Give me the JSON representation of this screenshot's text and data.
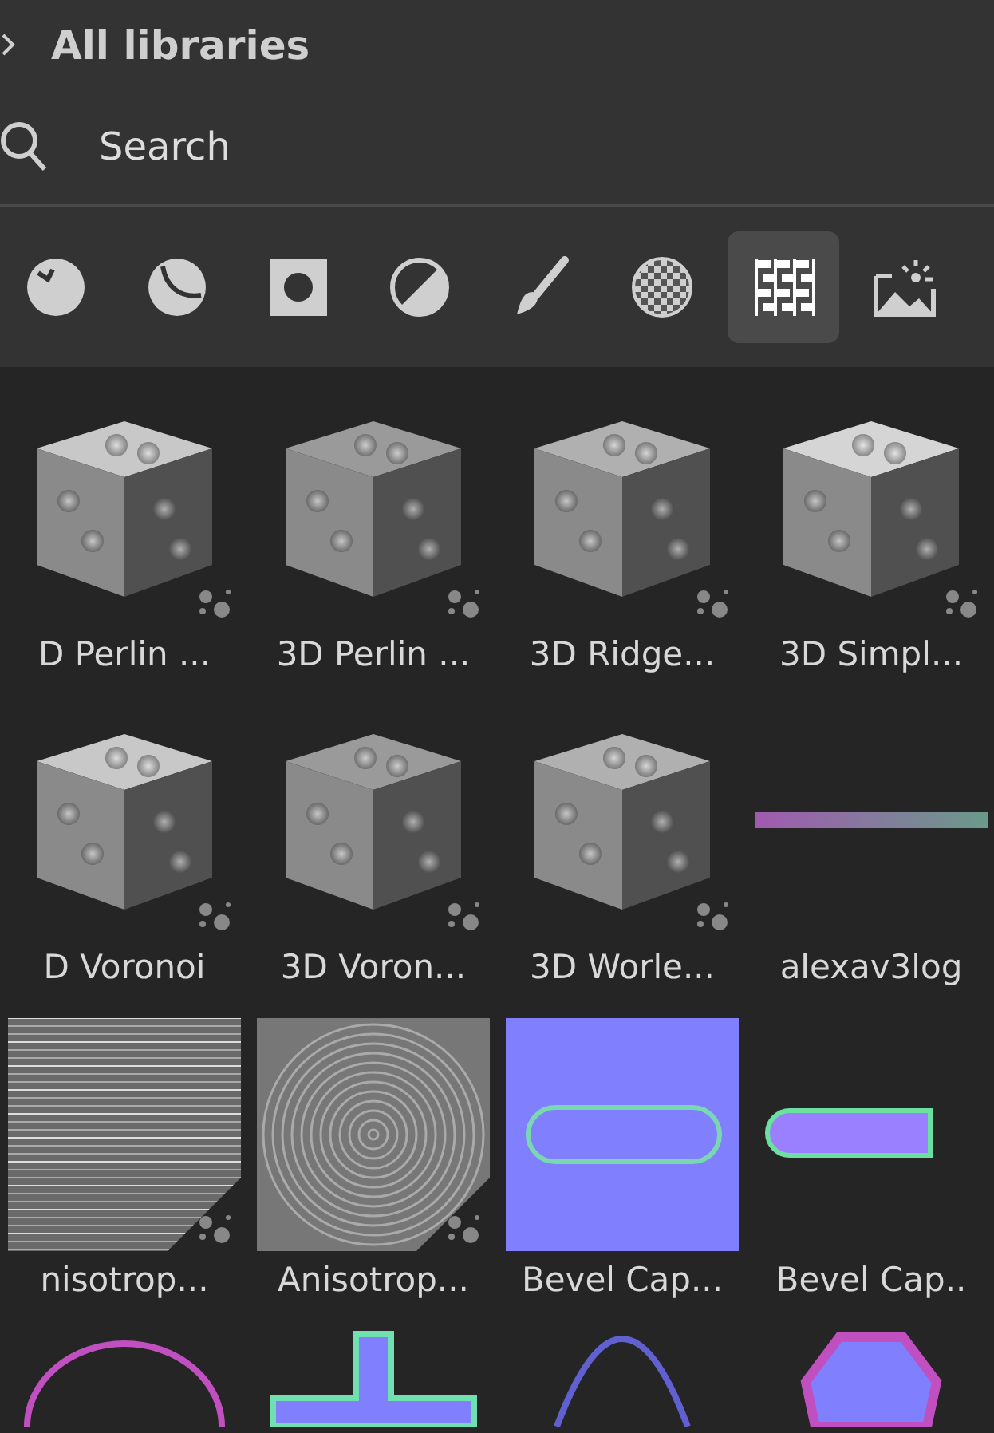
{
  "header": {
    "title": "All libraries"
  },
  "search": {
    "placeholder": "Search"
  },
  "filters": [
    {
      "kind": "sphere-check",
      "selected": false
    },
    {
      "kind": "ball",
      "selected": false
    },
    {
      "kind": "square-dot",
      "selected": false
    },
    {
      "kind": "half-circle",
      "selected": false
    },
    {
      "kind": "brush",
      "selected": false
    },
    {
      "kind": "checker",
      "selected": false
    },
    {
      "kind": "pattern",
      "selected": true
    },
    {
      "kind": "image",
      "selected": false
    }
  ],
  "items": [
    {
      "label": "D Perlin ...",
      "kind": "cube",
      "procedural": true
    },
    {
      "label": "3D Perlin ...",
      "kind": "cube",
      "procedural": true
    },
    {
      "label": "3D Ridge...",
      "kind": "cube",
      "procedural": true
    },
    {
      "label": "3D Simpl...",
      "kind": "cube",
      "procedural": true
    },
    {
      "label": "D Voronoi",
      "kind": "cube",
      "procedural": true
    },
    {
      "label": "3D Voron...",
      "kind": "cube",
      "procedural": true
    },
    {
      "label": "3D Worle...",
      "kind": "cube",
      "procedural": true
    },
    {
      "label": "alexav3log",
      "kind": "strip",
      "procedural": false
    },
    {
      "label": "nisotrop...",
      "kind": "lines",
      "procedural": true
    },
    {
      "label": "Anisotrop...",
      "kind": "swirl",
      "procedural": true
    },
    {
      "label": "Bevel Cap...",
      "kind": "bevel-square",
      "procedural": false
    },
    {
      "label": "Bevel Cap..",
      "kind": "bevel-bar",
      "procedural": false
    },
    {
      "kind": "arc",
      "procedural": false
    },
    {
      "kind": "cross",
      "procedural": false
    },
    {
      "kind": "arch",
      "procedural": false
    },
    {
      "kind": "hexagon",
      "procedural": false
    }
  ]
}
